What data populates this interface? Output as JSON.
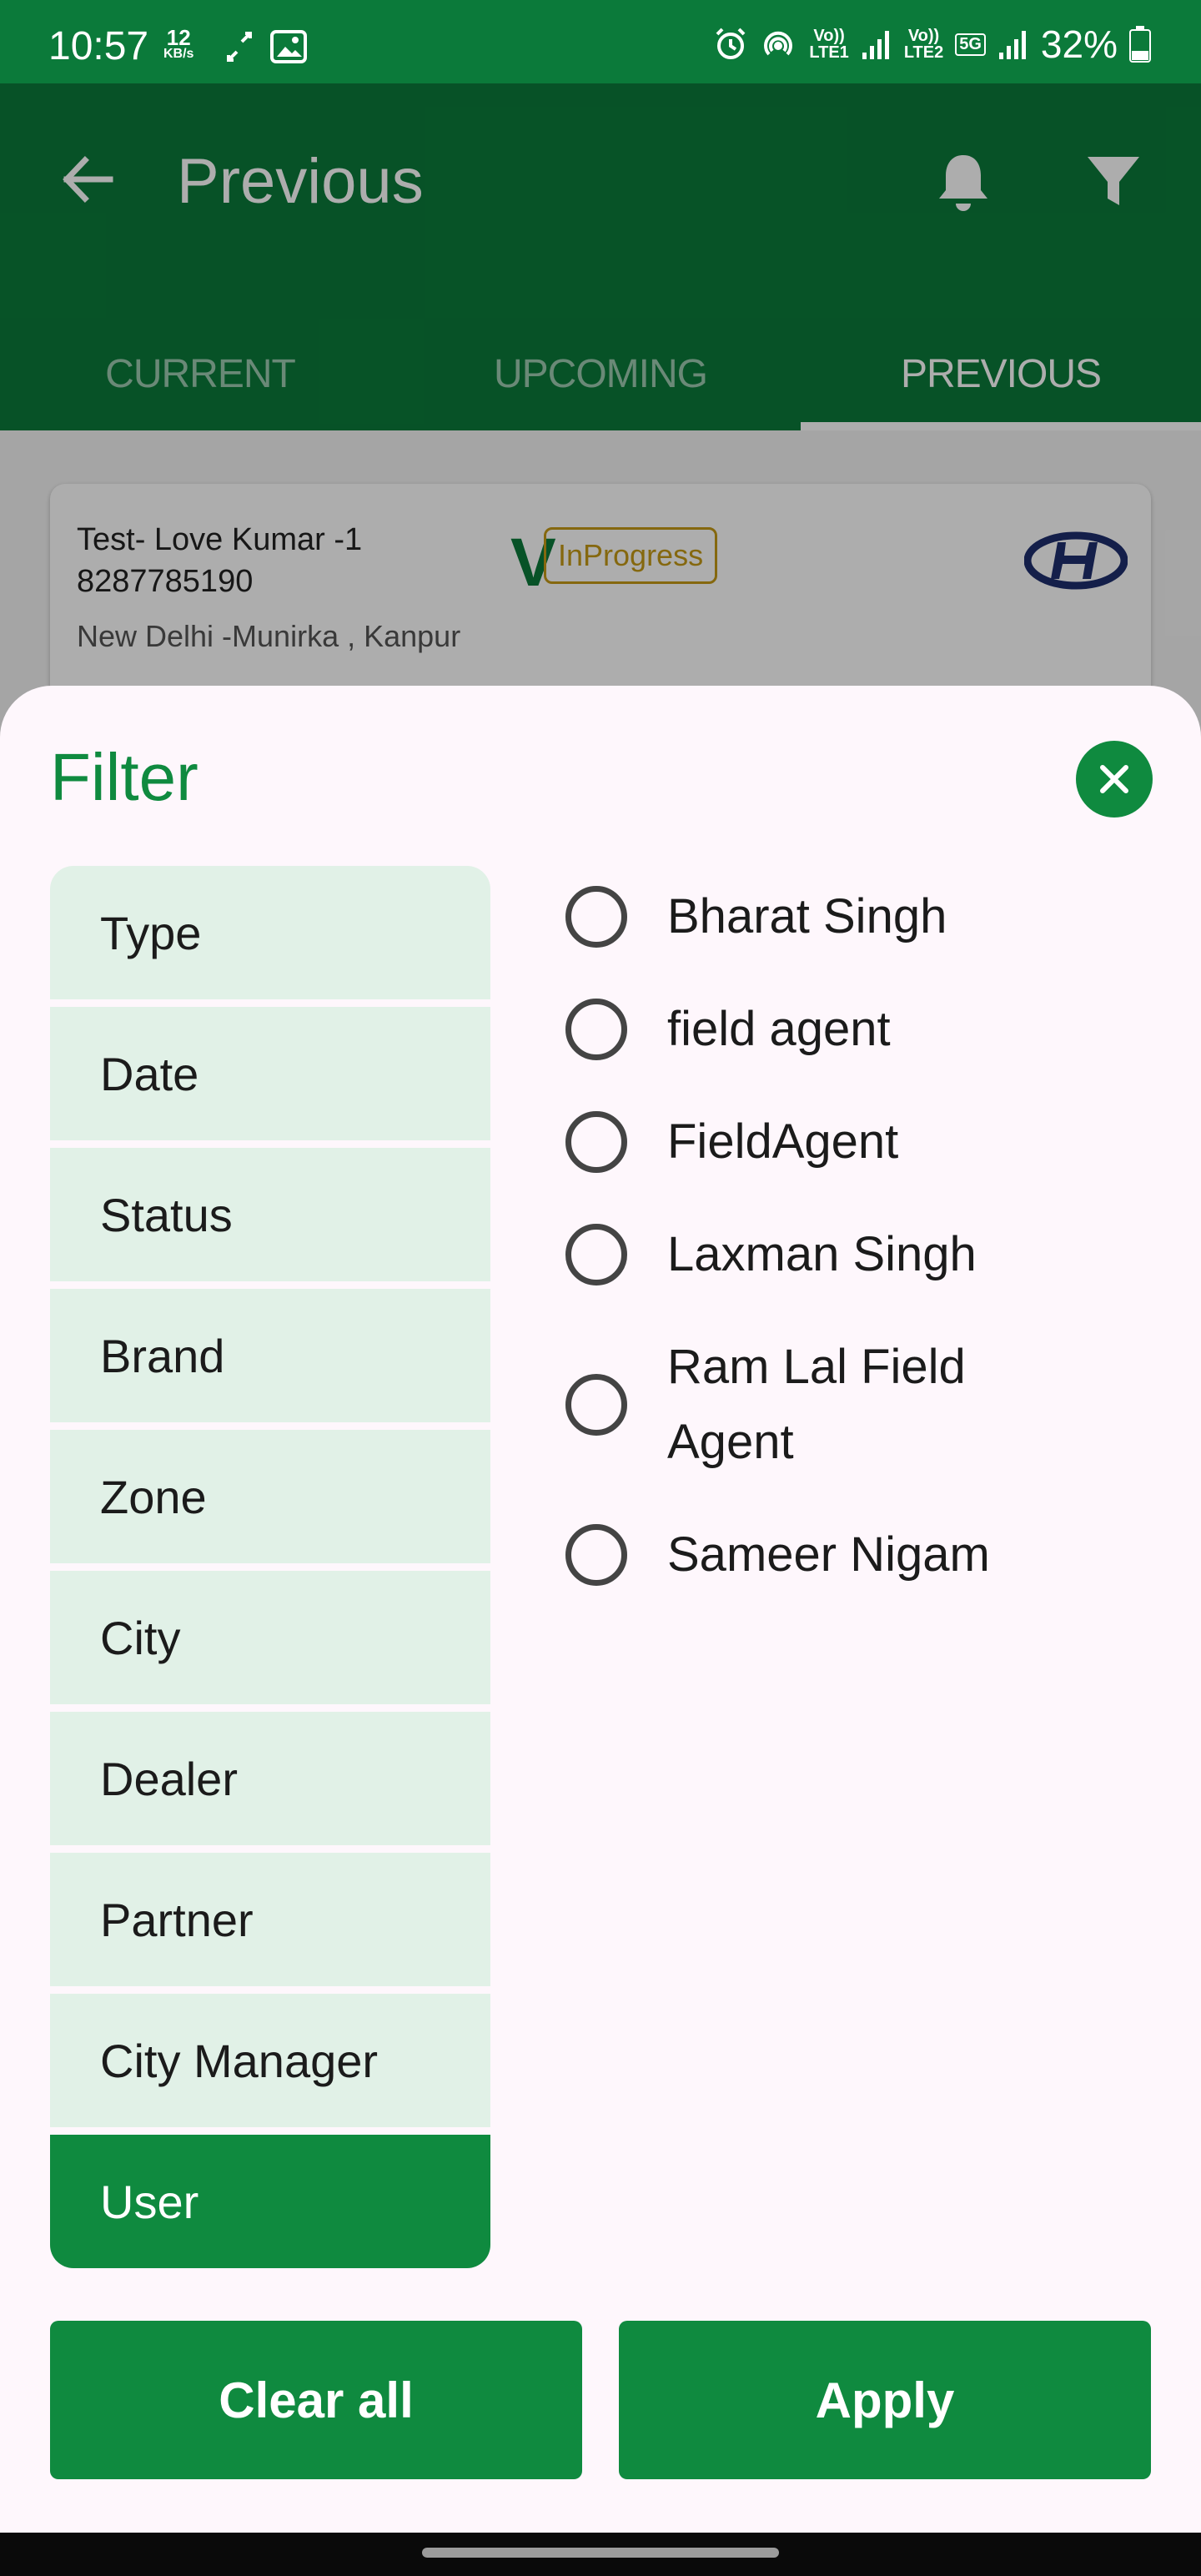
{
  "status_bar": {
    "time": "10:57",
    "speed_value": "12",
    "speed_unit": "KB/s",
    "sim1": "LTE1",
    "sim2": "LTE2",
    "network": "5G",
    "battery": "32%"
  },
  "app_bar": {
    "title": "Previous",
    "tabs": [
      {
        "label": "CURRENT",
        "active": false
      },
      {
        "label": "UPCOMING",
        "active": false
      },
      {
        "label": "PREVIOUS",
        "active": true
      }
    ]
  },
  "card": {
    "name": "Test- Love Kumar -1",
    "phone": "8287785190",
    "verified_mark": "V",
    "status": "InProgress",
    "address": "New Delhi -Munirka , Kanpur",
    "brand_logo": "hyundai-logo"
  },
  "filter": {
    "title": "Filter",
    "categories": [
      "Type",
      "Date",
      "Status",
      "Brand",
      "Zone",
      "City",
      "Dealer",
      "Partner",
      "City Manager",
      "User"
    ],
    "selected_category": "User",
    "options": [
      "Bharat Singh",
      "field agent",
      "FieldAgent",
      "Laxman Singh",
      "Ram Lal Field Agent",
      "Sameer Nigam"
    ],
    "clear_label": "Clear all",
    "apply_label": "Apply"
  },
  "colors": {
    "primary": "#0b7a3a",
    "accent": "#0f8a3f",
    "category_bg": "#e1f1e7",
    "badge": "#c59a17",
    "sheet_bg": "#fef7fc"
  }
}
